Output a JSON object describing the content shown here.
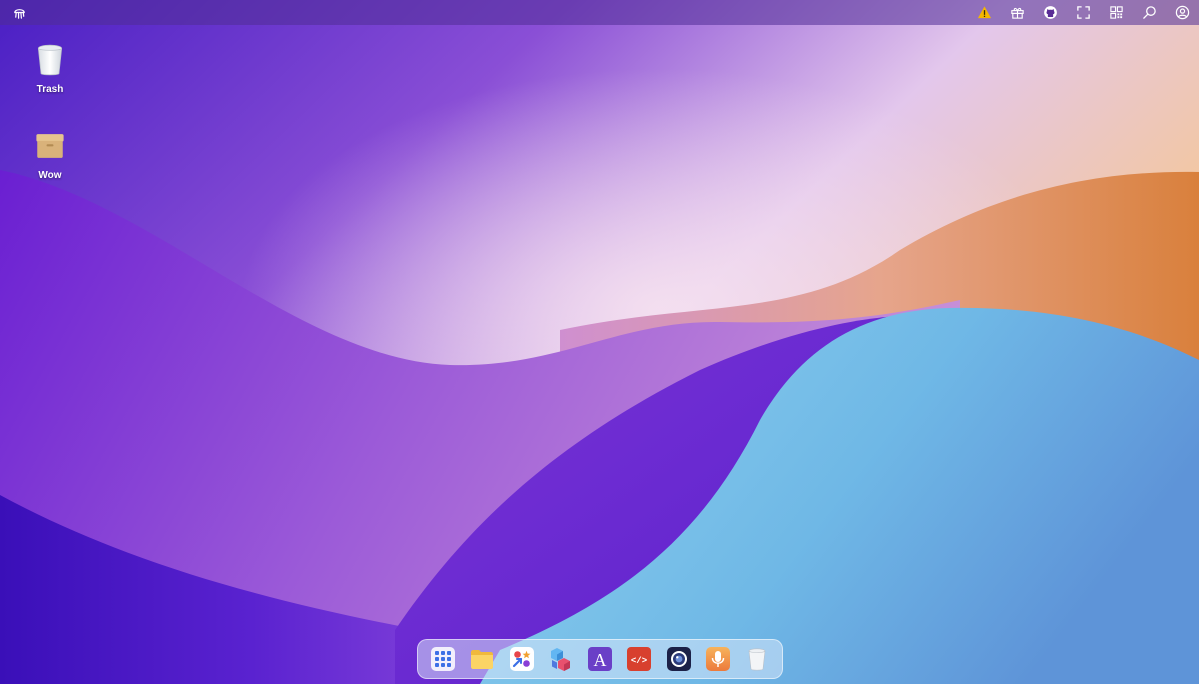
{
  "theme": {
    "menubar_bg": "#5a2d96",
    "dock_bg": "#d7e6fa",
    "warning_color": "#f5b700"
  },
  "menubar": {
    "logo_icon": "jellyfish-logo-icon",
    "right_icons": [
      "warning-icon",
      "gift-icon",
      "github-icon",
      "fullscreen-icon",
      "qr-code-icon",
      "search-icon",
      "user-account-icon"
    ]
  },
  "desktop": {
    "icons": [
      {
        "id": "trash",
        "label": "Trash",
        "icon": "trash-bin-icon"
      },
      {
        "id": "wow",
        "label": "Wow",
        "icon": "package-box-icon"
      }
    ]
  },
  "dock": {
    "items": [
      {
        "id": "launchpad",
        "icon": "app-grid-icon"
      },
      {
        "id": "files",
        "icon": "folder-icon"
      },
      {
        "id": "app-store",
        "icon": "app-store-icon"
      },
      {
        "id": "blocks",
        "icon": "cubes-icon"
      },
      {
        "id": "font-viewer",
        "icon": "font-a-icon",
        "glyph": "A"
      },
      {
        "id": "code-editor",
        "icon": "code-editor-icon",
        "glyph": "</>"
      },
      {
        "id": "camera",
        "icon": "camera-lens-icon"
      },
      {
        "id": "voice-recorder",
        "icon": "microphone-icon"
      },
      {
        "id": "trash",
        "icon": "trash-bin-icon"
      }
    ]
  }
}
